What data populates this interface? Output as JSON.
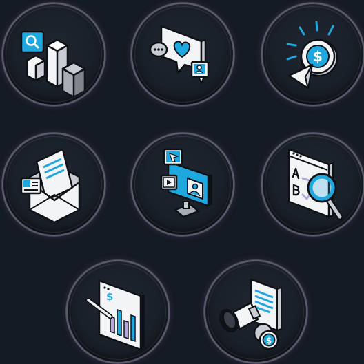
{
  "palette": {
    "background": "#151b24",
    "accent": "#1fa8e0",
    "outline": "#0e1116",
    "paper": "#f3f4f6",
    "shade": "#c9ccd2",
    "lavender": "#b3a8d6"
  },
  "icons": [
    {
      "name": "analytics-search-icon"
    },
    {
      "name": "social-engagement-icon"
    },
    {
      "name": "click-to-pay-icon"
    },
    {
      "name": "email-marketing-icon"
    },
    {
      "name": "display-advertising-icon"
    },
    {
      "name": "ab-testing-icon"
    },
    {
      "name": "sales-report-icon"
    },
    {
      "name": "paid-promotion-icon"
    }
  ]
}
